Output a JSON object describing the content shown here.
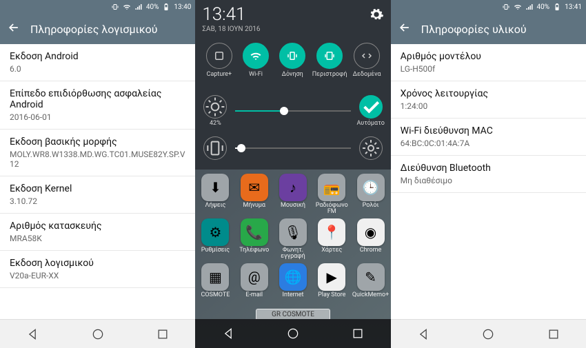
{
  "status": {
    "battery": "40%",
    "time1": "13:40",
    "time2": "13:41",
    "time3": "13:41"
  },
  "screen1": {
    "title": "Πληροφορίες λογισμικού",
    "items": [
      {
        "label": "Εκδοση Android",
        "value": "6.0"
      },
      {
        "label": "Επίπεδο επιδιόρθωσης ασφαλείας Android",
        "value": "2016-06-01"
      },
      {
        "label": "Εκδοση βασικής μορφής",
        "value": "MOLY.WR8.W1338.MD.WG.TC01.MUSE82Y.SP.V12"
      },
      {
        "label": "Εκδοση Kernel",
        "value": "3.10.72"
      },
      {
        "label": "Αριθμός κατασκευής",
        "value": "MRA58K"
      },
      {
        "label": "Εκδοση λογισμικού",
        "value": "V20a-EUR-XX"
      }
    ]
  },
  "screen2": {
    "time": "13:41",
    "date": "ΣΑΒ, 18 ΙΟΥΝ 2016",
    "tiles": [
      {
        "label": "Capture+",
        "on": false
      },
      {
        "label": "Wi-Fi",
        "on": true
      },
      {
        "label": "Δόνηση",
        "on": true
      },
      {
        "label": "Περιστροφή",
        "on": true
      },
      {
        "label": "Δεδομένα",
        "on": false
      }
    ],
    "brightness": {
      "label": "42%",
      "value": 42,
      "auto": "Αυτόματο",
      "auto_on": true
    },
    "volume": {
      "value": 5
    },
    "apps": [
      {
        "label": "Λήψεις",
        "bg": "ic-gray",
        "glyph": "⬇"
      },
      {
        "label": "Μήνυμα",
        "bg": "ic-orange",
        "glyph": "✉"
      },
      {
        "label": "Μουσική",
        "bg": "ic-purple",
        "glyph": "♪"
      },
      {
        "label": "Ραδιόφωνο FM",
        "bg": "ic-gray",
        "glyph": "📻"
      },
      {
        "label": "Ρολόι",
        "bg": "ic-gray",
        "glyph": "🕒"
      },
      {
        "label": "Ρυθμίσεις",
        "bg": "ic-teal",
        "glyph": "⚙"
      },
      {
        "label": "Τηλέφωνο",
        "bg": "ic-green",
        "glyph": "📞"
      },
      {
        "label": "Φωνητ. εγγραφή",
        "bg": "ic-gray",
        "glyph": "🎙"
      },
      {
        "label": "Χάρτες",
        "bg": "ic-white",
        "glyph": "📍"
      },
      {
        "label": "Chrome",
        "bg": "ic-white",
        "glyph": "◉"
      },
      {
        "label": "COSMOTE",
        "bg": "ic-gray",
        "glyph": "▦"
      },
      {
        "label": "E-mail",
        "bg": "ic-gray",
        "glyph": "@"
      },
      {
        "label": "Internet",
        "bg": "ic-blue",
        "glyph": "🌐"
      },
      {
        "label": "Play Store",
        "bg": "ic-white",
        "glyph": "▶"
      },
      {
        "label": "QuickMemo+",
        "bg": "ic-gray",
        "glyph": "✎"
      }
    ],
    "carrier": "GR COSMOTE"
  },
  "screen3": {
    "title": "Πληροφορίες υλικού",
    "items": [
      {
        "label": "Αριθμός μοντέλου",
        "value": "LG-H500f"
      },
      {
        "label": "Χρόνος λειτουργίας",
        "value": "1:24:00"
      },
      {
        "label": "Wi-Fi διεύθυνση MAC",
        "value": "64:BC:0C:01:4A:7A"
      },
      {
        "label": "Διεύθυνση Bluetooth",
        "value": "Μη διαθέσιμο"
      }
    ]
  }
}
